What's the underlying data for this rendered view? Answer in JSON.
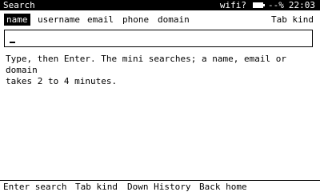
{
  "status_bar": {
    "title": "Search",
    "wifi": "wifi?",
    "battery_icon": "battery-icon",
    "battery_text": "--%",
    "time": "22:03"
  },
  "kinds": {
    "items": [
      "name",
      "username",
      "email",
      "phone",
      "domain"
    ],
    "active": "name",
    "hint": "Tab kind"
  },
  "search": {
    "value": "",
    "placeholder": ""
  },
  "help": {
    "text": "Type, then Enter. The mini searches; a name, email or domain\ntakes 2 to 4 minutes."
  },
  "bottom_bar": {
    "hints": [
      "Enter search",
      "Tab kind",
      "Down History",
      "Back home"
    ]
  }
}
